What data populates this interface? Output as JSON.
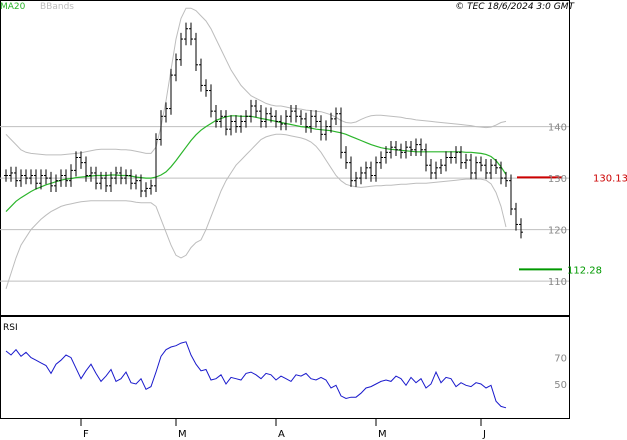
{
  "header": {
    "legend_ma": "MA20",
    "legend_bb": "BBands",
    "copyright": "© TEC 18/6/2024 3:0 GMT"
  },
  "colors": {
    "price_bar": "#000000",
    "ma20": "#2bb52b",
    "bbands": "#bdbdbd",
    "resistance": "#cc0000",
    "support": "#009900",
    "rsi": "#1a1acc",
    "grid": "#bfbfbf",
    "axis_text": "#888888"
  },
  "chart_data": [
    {
      "type": "ohlc",
      "ylim": [
        104,
        164
      ],
      "y_ticks": [
        {
          "value": 140,
          "label": "140"
        },
        {
          "value": 130,
          "label": "130"
        },
        {
          "value": 120,
          "label": "120"
        },
        {
          "value": 110,
          "label": "110"
        }
      ],
      "x_ticks": [
        {
          "index": 15,
          "label": "F"
        },
        {
          "index": 34,
          "label": "M"
        },
        {
          "index": 54,
          "label": "A"
        },
        {
          "index": 74,
          "label": "M"
        },
        {
          "index": 95,
          "label": "J"
        }
      ],
      "close": [
        130.5,
        131,
        129.5,
        130.5,
        130,
        130.5,
        129,
        130.5,
        130,
        128.5,
        129.5,
        130.5,
        129.5,
        131.5,
        134,
        133,
        130.5,
        131,
        129,
        130,
        128.5,
        130,
        131,
        130,
        130.5,
        129,
        129.5,
        127.5,
        128,
        128.5,
        137.5,
        142,
        143.5,
        150,
        153,
        157,
        159,
        157,
        152,
        148,
        147,
        143,
        141,
        142,
        139.5,
        141,
        140,
        141,
        142,
        144,
        143,
        141,
        142.5,
        142,
        141,
        140.5,
        142,
        143,
        142,
        141.5,
        140,
        142,
        141,
        138.5,
        140,
        141.5,
        142.5,
        135,
        133,
        129.5,
        130,
        131,
        132,
        130.5,
        133,
        134,
        135,
        136,
        135.5,
        135,
        136,
        135.5,
        136.5,
        135.5,
        132.5,
        131,
        132,
        132.5,
        134,
        134,
        135,
        133,
        133.5,
        131,
        133,
        132.5,
        131,
        132.5,
        132,
        130,
        129.5,
        124,
        121,
        119.5
      ],
      "ma20": [
        123.5,
        124.5,
        125.5,
        126.2,
        126.8,
        127.4,
        127.9,
        128.3,
        128.7,
        129,
        129.3,
        129.6,
        129.8,
        129.9,
        130.1,
        130.2,
        130.3,
        130.4,
        130.5,
        130.5,
        130.5,
        130.6,
        130.6,
        130.5,
        130.5,
        130.4,
        130.2,
        130.1,
        130,
        130,
        130.2,
        130.6,
        131.2,
        132.2,
        133.4,
        134.7,
        136,
        137.3,
        138.4,
        139.3,
        140,
        140.6,
        141.2,
        141.6,
        141.9,
        142.1,
        142.1,
        142,
        142,
        142,
        141.8,
        141.6,
        141.4,
        141.2,
        141,
        140.8,
        140.6,
        140.4,
        140.2,
        140,
        139.9,
        139.7,
        139.5,
        139.4,
        139.3,
        139.2,
        139,
        138.8,
        138.5,
        138.1,
        137.7,
        137.3,
        136.9,
        136.5,
        136.2,
        135.9,
        135.7,
        135.6,
        135.5,
        135.4,
        135.3,
        135.2,
        135.1,
        135.1,
        135.1,
        135.1,
        135.1,
        135.1,
        135.1,
        135.1,
        135.1,
        135.1,
        135,
        135,
        134.9,
        134.8,
        134.6,
        134.2,
        133.4,
        132.2,
        130.7
      ],
      "bb_upper": [
        138.5,
        137.5,
        136.5,
        135.5,
        135,
        134.8,
        134.7,
        134.6,
        134.5,
        134.5,
        134.5,
        134.5,
        134.6,
        134.7,
        134.8,
        134.9,
        135.1,
        135.3,
        135.5,
        135.6,
        135.6,
        135.6,
        135.6,
        135.5,
        135.5,
        135.4,
        135.2,
        135,
        134.8,
        134.8,
        136,
        140,
        145,
        151,
        157,
        161,
        163,
        163,
        162.5,
        161.5,
        160.5,
        159,
        157,
        155,
        153,
        151,
        149.5,
        148,
        147,
        146,
        145.5,
        145,
        144.5,
        144.2,
        144,
        144,
        143.8,
        143.6,
        143.5,
        143.4,
        143.2,
        143.1,
        143,
        142.9,
        142.6,
        142.3,
        141.8,
        141.2,
        140.8,
        140.7,
        140.9,
        141.4,
        141.8,
        142.1,
        142.2,
        142.2,
        142.1,
        142,
        141.9,
        141.8,
        141.6,
        141.5,
        141.3,
        141.2,
        141.1,
        141,
        140.9,
        140.8,
        140.7,
        140.6,
        140.5,
        140.4,
        140.3,
        140.2,
        140,
        139.9,
        139.8,
        139.9,
        140.3,
        140.8,
        141
      ],
      "bb_lower": [
        108.5,
        111.5,
        114.5,
        117,
        118.5,
        120,
        121,
        122,
        122.8,
        123.5,
        124,
        124.5,
        124.8,
        125,
        125.2,
        125.4,
        125.5,
        125.6,
        125.6,
        125.6,
        125.6,
        125.6,
        125.6,
        125.6,
        125.6,
        125.5,
        125.3,
        125.2,
        125.2,
        125.2,
        124.5,
        122,
        119.5,
        117,
        115,
        114.5,
        115,
        116.5,
        117.5,
        118,
        120,
        122.5,
        125,
        127.5,
        129.5,
        131,
        132.5,
        133.5,
        134.5,
        135.5,
        136.5,
        137.5,
        138,
        138.3,
        138.5,
        138.5,
        138.4,
        138.2,
        138,
        137.8,
        137.5,
        137,
        136.2,
        135,
        133.5,
        132,
        130.5,
        129.5,
        128.8,
        128.5,
        128.3,
        128.2,
        128.3,
        128.4,
        128.5,
        128.5,
        128.6,
        128.6,
        128.7,
        128.8,
        128.8,
        128.9,
        129,
        129,
        129,
        129.1,
        129.2,
        129.3,
        129.4,
        129.5,
        129.6,
        129.7,
        129.8,
        129.8,
        129.8,
        129.8,
        129.6,
        128.9,
        127.2,
        124.5,
        120.5
      ],
      "resistance": {
        "value": 130.13,
        "label": "130.13"
      },
      "support": {
        "value": 112.28,
        "label": "112.28"
      }
    },
    {
      "type": "line",
      "title": "RSI",
      "ylim": [
        25,
        100
      ],
      "y_ticks": [
        {
          "value": 70,
          "label": "70"
        },
        {
          "value": 50,
          "label": "50"
        }
      ],
      "values": [
        75,
        72,
        76,
        71,
        74,
        70,
        68,
        66,
        64,
        58,
        65,
        68,
        72,
        70,
        62,
        54,
        60,
        65,
        58,
        52,
        56,
        61,
        52,
        54,
        59,
        51,
        50,
        54,
        46,
        48,
        59,
        71,
        76,
        78,
        79,
        81,
        82,
        72,
        65,
        60,
        61,
        53,
        54,
        57,
        50,
        55,
        54,
        53,
        58,
        59,
        57,
        54,
        58,
        57,
        53,
        56,
        54,
        52,
        57,
        56,
        58,
        54,
        53,
        55,
        53,
        47,
        49,
        41,
        39,
        40,
        40,
        43,
        47,
        48,
        50,
        52,
        53,
        52,
        56,
        54,
        49,
        55,
        51,
        54,
        47,
        50,
        59,
        51,
        55,
        54,
        48,
        51,
        49,
        48,
        51,
        50,
        47,
        49,
        37,
        33,
        32
      ]
    }
  ]
}
